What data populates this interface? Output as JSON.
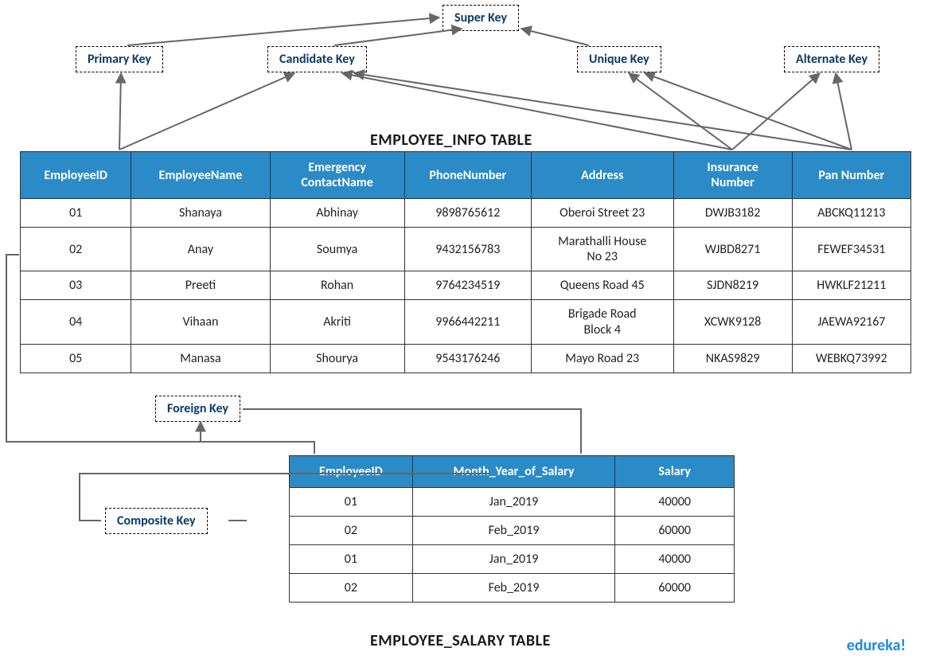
{
  "keys": {
    "super": "Super Key",
    "primary": "Primary Key",
    "candidate": "Candidate Key",
    "unique": "Unique Key",
    "alternate": "Alternate Key",
    "foreign": "Foreign Key",
    "composite": "Composite Key"
  },
  "table1": {
    "title": "EMPLOYEE_INFO TABLE",
    "headers": [
      "EmployeeID",
      "EmployeeName",
      "Emergency ContactName",
      "PhoneNumber",
      "Address",
      "Insurance Number",
      "Pan Number"
    ],
    "rows": [
      [
        "01",
        "Shanaya",
        "Abhinay",
        "9898765612",
        "Oberoi Street 23",
        "DWJB3182",
        "ABCKQ11213"
      ],
      [
        "02",
        "Anay",
        "Soumya",
        "9432156783",
        "Marathalli House No 23",
        "WJBD8271",
        "FEWEF34531"
      ],
      [
        "03",
        "Preeti",
        "Rohan",
        "9764234519",
        "Queens Road 45",
        "SJDN8219",
        "HWKLF21211"
      ],
      [
        "04",
        "Vihaan",
        "Akriti",
        "9966442211",
        "Brigade Road Block 4",
        "XCWK9128",
        "JAEWA92167"
      ],
      [
        "05",
        "Manasa",
        "Shourya",
        "9543176246",
        "Mayo Road 23",
        "NKAS9829",
        "WEBKQ73992"
      ]
    ]
  },
  "table2": {
    "title": "EMPLOYEE_SALARY TABLE",
    "headers": [
      "EmployeeID",
      "Month_Year_of_Salary",
      "Salary"
    ],
    "rows": [
      [
        "01",
        "Jan_2019",
        "40000"
      ],
      [
        "02",
        "Feb_2019",
        "60000"
      ],
      [
        "01",
        "Jan_2019",
        "40000"
      ],
      [
        "02",
        "Feb_2019",
        "60000"
      ]
    ]
  },
  "brand": "edureka!"
}
